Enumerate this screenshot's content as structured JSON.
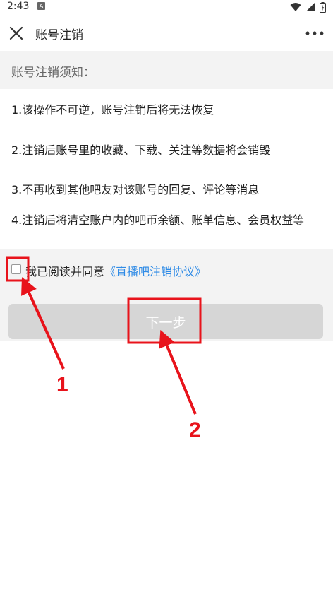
{
  "status_bar": {
    "time": "2:43",
    "badge": "A"
  },
  "app_bar": {
    "title": "账号注销"
  },
  "notice": {
    "header": "账号注销须知：",
    "items": [
      "1.该操作不可逆，账号注销后将无法恢复",
      "2.注销后账号里的收藏、下载、关注等数据将会销毁",
      "3.不再收到其他吧友对该账号的回复、评论等消息",
      "4.注销后将清空账户内的吧币余额、账单信息、会员权益等"
    ]
  },
  "agreement": {
    "checked": false,
    "text": "我已阅读并同意",
    "link": "《直播吧注销协议》"
  },
  "next_button": {
    "label": "下一步"
  },
  "annotations": {
    "label_1": "1",
    "label_2": "2",
    "color": "#e8131b"
  },
  "colors": {
    "link": "#2f8be6",
    "notice_bg": "#f3f3f3",
    "button_bg": "#d6d6d6"
  }
}
